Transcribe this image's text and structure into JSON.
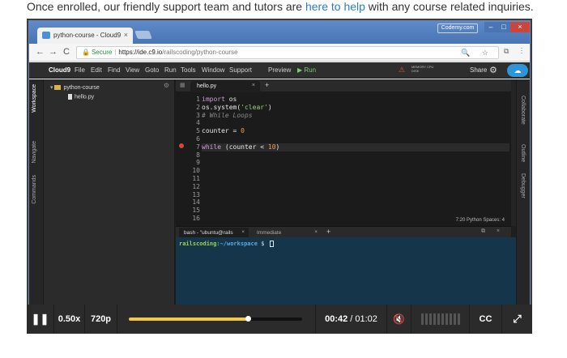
{
  "intro": {
    "before": "Once enrolled, our friendly support team and tutors are ",
    "link": "here to help",
    "after": " with any course related inquiries."
  },
  "browser": {
    "tab_title": "python-course - Cloud9",
    "tab_close": "×",
    "badge": "Codemy.com",
    "win_min": "–",
    "win_max": "□",
    "win_close": "×",
    "back": "←",
    "forward": "→",
    "reload": "C",
    "secure_label": "Secure",
    "url_host": "https://ide.c9.io",
    "url_path": "/railscoding/python-course",
    "omni_icons": "🔍 ☆",
    "ext_icons": "⧉ ⋮"
  },
  "c9": {
    "logo": "Cloud9",
    "menu": [
      "File",
      "Edit",
      "Find",
      "View",
      "Goto",
      "Run",
      "Tools",
      "Window",
      "Support",
      "Preview",
      "▶ Run"
    ],
    "memory": "MEMORY CPU DISK",
    "share": "Share",
    "left_tabs": [
      "Workspace",
      "Navigate",
      "Commands"
    ],
    "right_tabs": [
      "Collaborate",
      "Outline",
      "Debugger"
    ],
    "tree": {
      "folder": "python-course",
      "file": "hello.py"
    },
    "editor_tab": "hello.py",
    "editor_tab_close": "×",
    "line_numbers": [
      "1",
      "2",
      "3",
      "4",
      "5",
      "6",
      "7",
      "8",
      "9",
      "10",
      "11",
      "12",
      "13",
      "14",
      "15",
      "16"
    ],
    "status": "7:20    Python    Spaces: 4",
    "terminal_tabs": [
      "bash - \"ubuntu@rails",
      "Immediate"
    ],
    "prompt_user": "railscoding",
    "prompt_path": ":~/workspace",
    "prompt_suffix": " $ "
  },
  "code": {
    "l1_kw": "import",
    "l1_rest": " os",
    "l2_pre": "os.system(",
    "l2_str": "'clear'",
    "l2_post": ")",
    "l3": "# While Loops",
    "l5_pre": "counter = ",
    "l5_num": "0",
    "l7_kw": "while",
    "l7_pre": " (counter < ",
    "l7_num": "10",
    "l7_post": ")"
  },
  "controls": {
    "play_pause_icon": "pause-icon",
    "play_pause": "❚❚",
    "speed": "0.50x",
    "quality": "720p",
    "progress": 0.685,
    "current_time": "00:42",
    "separator": " / ",
    "duration": "01:02",
    "mute": "🔇",
    "volume_level": 0,
    "cc": "CC",
    "fullscreen": "⤢"
  },
  "colors": {
    "link": "#2a7fc4",
    "seek_fill": "#f3c747",
    "terminal_bg": "#15364a"
  }
}
